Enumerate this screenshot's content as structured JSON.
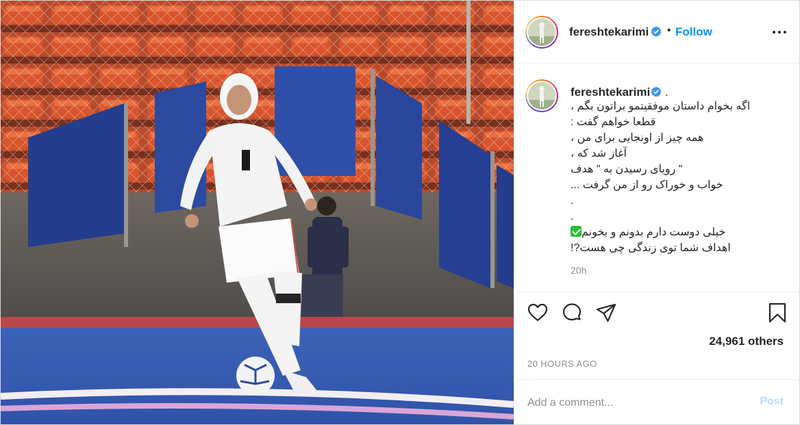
{
  "post": {
    "username": "fereshtekarimi",
    "follow_label": "Follow",
    "separator": "•",
    "caption_username": "fereshtekarimi",
    "caption_username_suffix": ".",
    "caption_lines": [
      "اگه بخوام داستان موفقیتمو براتون بگم ،",
      "قطعا خواهم گفت :",
      "همه چیز از اونجایی برای من ،",
      "آغاز شد که ،",
      "\" رویای رسیدن به \" هدف",
      "خواب و خوراک رو از من گرفت ...",
      ".",
      ".",
      "خیلی دوست دارم بدونم و بخونم",
      "اهداف شما توی زندگی چی هست?!"
    ],
    "caption_emoji": "white-check-mark",
    "time_ago": "20h",
    "likes_text": "24,961 others",
    "date_text": "20 HOURS AGO"
  },
  "comment": {
    "placeholder": "Add a comment...",
    "post_label": "Post"
  },
  "colors": {
    "follow_blue": "#0095f6",
    "post_disabled": "#b2dffc",
    "verified_blue": "#3897f0",
    "muted_text": "#8e8e8e"
  },
  "icons": [
    "heart-icon",
    "comment-icon",
    "share-icon",
    "bookmark-icon",
    "more-options-icon",
    "verified-badge-icon"
  ]
}
